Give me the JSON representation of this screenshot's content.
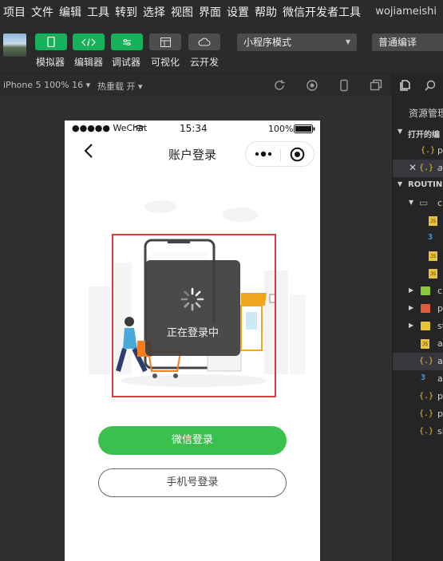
{
  "menu": {
    "items": [
      "项目",
      "文件",
      "编辑",
      "工具",
      "转到",
      "选择",
      "视图",
      "界面",
      "设置",
      "帮助",
      "微信开发者工具"
    ],
    "user": "wojiameishi"
  },
  "toolbar": {
    "buttons": [
      {
        "label": "模拟器"
      },
      {
        "label": "编辑器"
      },
      {
        "label": "调试器"
      },
      {
        "label": "可视化"
      },
      {
        "label": "云开发"
      }
    ],
    "mode_select": "小程序模式",
    "compile_select": "普通编译"
  },
  "simbar": {
    "device": "iPhone 5 100% 16",
    "hot_reload": "热重载 开"
  },
  "phone": {
    "status": {
      "carrier": "●●●●● WeChat",
      "time": "15:34",
      "battery": "100%"
    },
    "nav_title": "账户登录",
    "toast_text": "正在登录中",
    "wechat_login": "微信登录",
    "phone_login": "手机号登录"
  },
  "explorer": {
    "title": "资源管理",
    "section_open": "打开的编",
    "section_root": "ROUTINE",
    "open_files": [
      "p",
      "a"
    ],
    "tree": [
      "c",
      "c",
      "p",
      "st",
      "a",
      "a",
      "a",
      "p",
      "p",
      "si"
    ]
  }
}
